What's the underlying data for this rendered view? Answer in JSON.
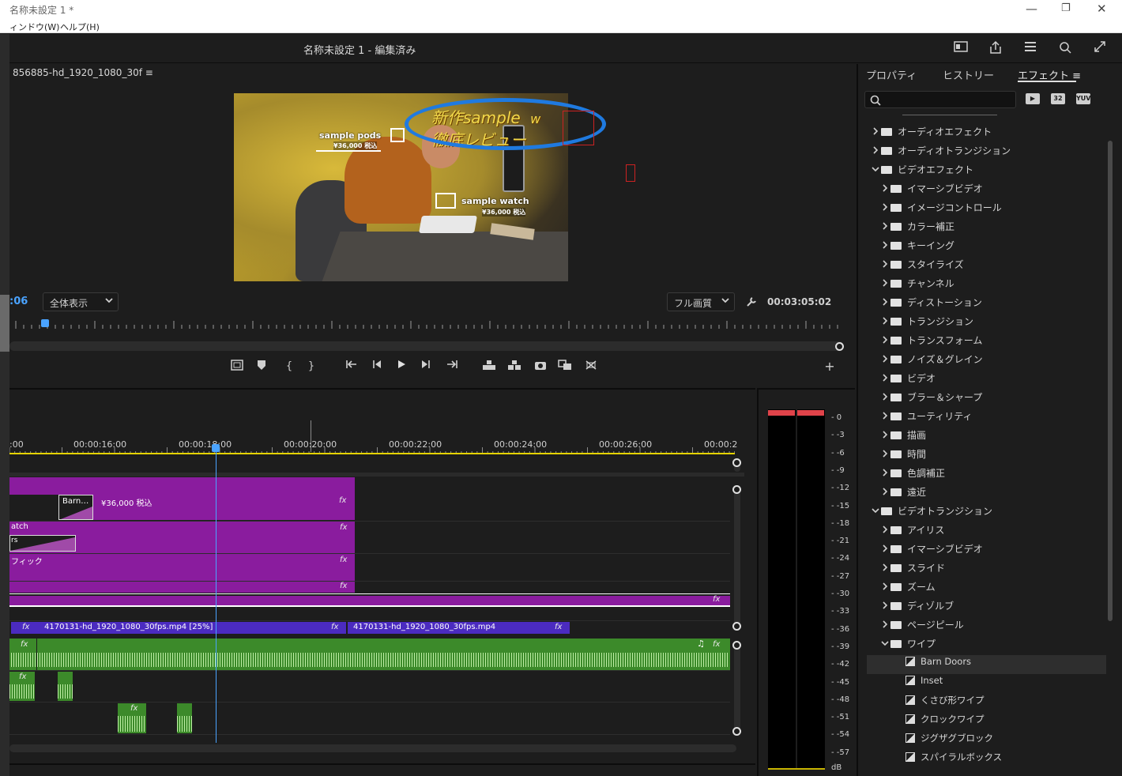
{
  "titlebar": {
    "title": "名称未設定 1 *",
    "minimize_glyph": "—",
    "restore_glyph": "❐",
    "close_glyph": "✕"
  },
  "menubar": {
    "window": "ィンドウ(W)",
    "help": "ヘルプ(H)"
  },
  "header": {
    "project_title": "名称未設定 1 - 編集済み"
  },
  "monitor": {
    "sequence_name": "856885-hd_1920_1080_30f ≡",
    "timecode_left": ":06",
    "fit_label": "全体表示",
    "quality_label": "フル画質",
    "duration": "00:03:05:02",
    "video": {
      "label_pods": "sample pods",
      "price_pods": "¥36,000 税込",
      "label_watch": "sample watch",
      "price_watch": "¥36,000 税込",
      "telop_line1": "新作sample",
      "telop_suffix": "w",
      "telop_line2": "徹底レビュー"
    },
    "accent_color": "#4aa3ff"
  },
  "transport": {
    "mark_in": "{",
    "mark_out": "}",
    "add": "+"
  },
  "timeline": {
    "timecodes": [
      ":00",
      "00:00:16:00",
      "00:00:18:00",
      "00:00:20:00",
      "00:00:22:00",
      "00:00:24:00",
      "00:00:26:00",
      "00:00:2"
    ],
    "clips": {
      "barn_doors": "Barn…",
      "price_text": "¥36,000 税込",
      "watch_partial": "atch",
      "rs_partial": "rs",
      "graphic_partial": "フィック",
      "video1_name": "4170131-hd_1920_1080_30fps.mp4 [25%]",
      "video2_name": "4170131-hd_1920_1080_30fps.mp4",
      "fx": "fx"
    },
    "colors": {
      "purple": "#8a1c9e",
      "blue": "#4b2bc0",
      "green": "#3c8a2a",
      "playhead": "#4aa3ff",
      "yellow": "#e5d200"
    }
  },
  "meter": {
    "scale": [
      "0",
      "-3",
      "-6",
      "-9",
      "-12",
      "-15",
      "-18",
      "-21",
      "-24",
      "-27",
      "-30",
      "-33",
      "-36",
      "-39",
      "-42",
      "-45",
      "-48",
      "-51",
      "-54",
      "-57",
      "dB"
    ],
    "peak_color": "#e0434a"
  },
  "effects_panel": {
    "tabs": [
      "プロパティ",
      "ヒストリー",
      "エフェクト ≡"
    ],
    "search_placeholder": "",
    "icon_labels": [
      "32",
      "YUV"
    ],
    "items": [
      {
        "label": "オーディオエフェクト",
        "level": 0,
        "expanded": false,
        "kind": "folder"
      },
      {
        "label": "オーディオトランジション",
        "level": 0,
        "expanded": false,
        "kind": "folder"
      },
      {
        "label": "ビデオエフェクト",
        "level": 0,
        "expanded": true,
        "kind": "folder"
      },
      {
        "label": "イマーシブビデオ",
        "level": 1,
        "expanded": false,
        "kind": "folder"
      },
      {
        "label": "イメージコントロール",
        "level": 1,
        "expanded": false,
        "kind": "folder"
      },
      {
        "label": "カラー補正",
        "level": 1,
        "expanded": false,
        "kind": "folder"
      },
      {
        "label": "キーイング",
        "level": 1,
        "expanded": false,
        "kind": "folder"
      },
      {
        "label": "スタイライズ",
        "level": 1,
        "expanded": false,
        "kind": "folder"
      },
      {
        "label": "チャンネル",
        "level": 1,
        "expanded": false,
        "kind": "folder"
      },
      {
        "label": "ディストーション",
        "level": 1,
        "expanded": false,
        "kind": "folder"
      },
      {
        "label": "トランジション",
        "level": 1,
        "expanded": false,
        "kind": "folder"
      },
      {
        "label": "トランスフォーム",
        "level": 1,
        "expanded": false,
        "kind": "folder"
      },
      {
        "label": "ノイズ＆グレイン",
        "level": 1,
        "expanded": false,
        "kind": "folder"
      },
      {
        "label": "ビデオ",
        "level": 1,
        "expanded": false,
        "kind": "folder"
      },
      {
        "label": "ブラー＆シャープ",
        "level": 1,
        "expanded": false,
        "kind": "folder"
      },
      {
        "label": "ユーティリティ",
        "level": 1,
        "expanded": false,
        "kind": "folder"
      },
      {
        "label": "描画",
        "level": 1,
        "expanded": false,
        "kind": "folder"
      },
      {
        "label": "時間",
        "level": 1,
        "expanded": false,
        "kind": "folder"
      },
      {
        "label": "色調補正",
        "level": 1,
        "expanded": false,
        "kind": "folder"
      },
      {
        "label": "遠近",
        "level": 1,
        "expanded": false,
        "kind": "folder"
      },
      {
        "label": "ビデオトランジション",
        "level": 0,
        "expanded": true,
        "kind": "folder"
      },
      {
        "label": "アイリス",
        "level": 1,
        "expanded": false,
        "kind": "folder"
      },
      {
        "label": "イマーシブビデオ",
        "level": 1,
        "expanded": false,
        "kind": "folder"
      },
      {
        "label": "スライド",
        "level": 1,
        "expanded": false,
        "kind": "folder"
      },
      {
        "label": "ズーム",
        "level": 1,
        "expanded": false,
        "kind": "folder"
      },
      {
        "label": "ディゾルブ",
        "level": 1,
        "expanded": false,
        "kind": "folder"
      },
      {
        "label": "ページピール",
        "level": 1,
        "expanded": false,
        "kind": "folder"
      },
      {
        "label": "ワイプ",
        "level": 1,
        "expanded": true,
        "kind": "folder"
      },
      {
        "label": "Barn Doors",
        "level": 2,
        "kind": "effect",
        "selected": true
      },
      {
        "label": "Inset",
        "level": 2,
        "kind": "effect"
      },
      {
        "label": "くさび形ワイプ",
        "level": 2,
        "kind": "effect"
      },
      {
        "label": "クロックワイプ",
        "level": 2,
        "kind": "effect"
      },
      {
        "label": "ジグザグブロック",
        "level": 2,
        "kind": "effect"
      },
      {
        "label": "スパイラルボックス",
        "level": 2,
        "kind": "effect"
      }
    ]
  }
}
